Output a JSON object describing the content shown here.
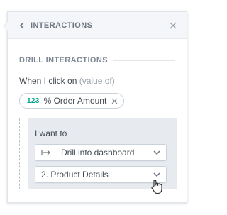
{
  "panel": {
    "header": {
      "title": "INTERACTIONS",
      "back_icon": "chevron-left-icon",
      "close_icon": "close-icon"
    },
    "section_title": "DRILL INTERACTIONS",
    "when": {
      "prefix": "When I click on",
      "suffix": "(value of)"
    },
    "measure_chip": {
      "type_label": "123",
      "label": "% Order Amount",
      "remove_icon": "close-icon"
    },
    "action": {
      "label": "I want to",
      "action_select": {
        "value": "Drill into dashboard",
        "icon": "drill-arrow-icon"
      },
      "target_select": {
        "value": "2. Product Details"
      }
    }
  },
  "colors": {
    "accent": "#00a48a",
    "header_bg": "#f4f6f9",
    "drill_bg": "#e7ebf0"
  }
}
